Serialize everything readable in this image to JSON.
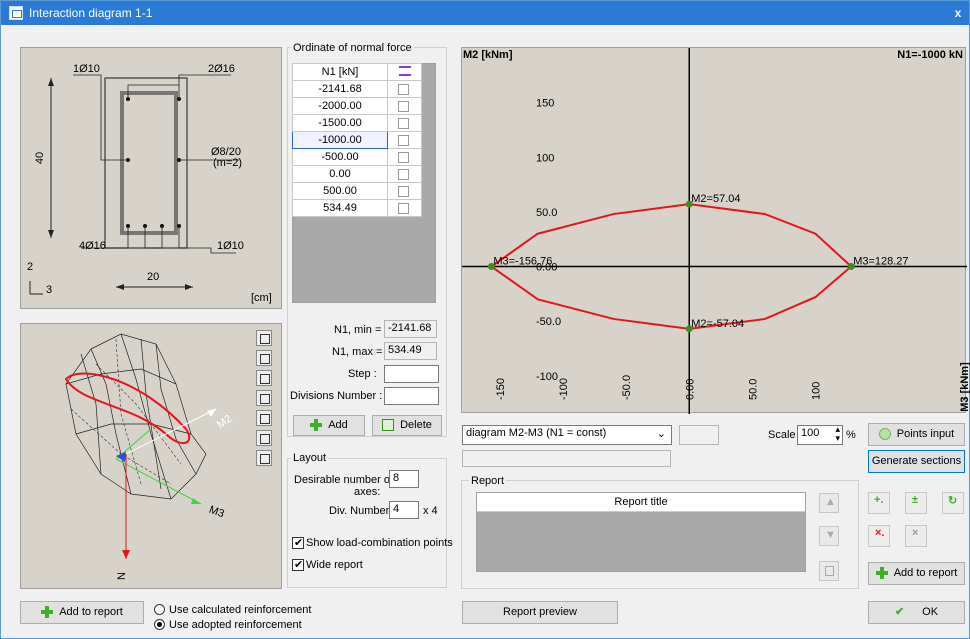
{
  "window": {
    "title": "Interaction diagram 1-1",
    "close_label": "x"
  },
  "section": {
    "label_top_left": "1Ø10",
    "label_top_right": "2Ø16",
    "label_stirrup": "Ø8/20",
    "label_stirrup_m": "(m=2)",
    "label_bottom_left": "4Ø16",
    "label_bottom_right": "1Ø10",
    "dim_height": "40",
    "dim_width": "20",
    "axis_2": "2",
    "axis_3": "3",
    "unit": "[cm]"
  },
  "view3d": {
    "label_m2": "M2",
    "label_m3": "M3",
    "label_n": "N"
  },
  "normal_force": {
    "title": "Ordinate of normal force",
    "col_header": "N1 [kN]",
    "rows": [
      "-2141.68",
      "-2000.00",
      "-1500.00",
      "-1000.00",
      "-500.00",
      "0.00",
      "500.00",
      "534.49"
    ],
    "n1_min_label": "N1, min =",
    "n1_min": "-2141.68",
    "n1_max_label": "N1, max =",
    "n1_max": "534.49",
    "step_label": "Step :",
    "step_value": "",
    "divisions_label": "Divisions Number :",
    "divisions_value": "",
    "add_label": "Add",
    "delete_label": "Delete"
  },
  "layout": {
    "title": "Layout",
    "desirable_label_1": "Desirable number of",
    "desirable_label_2": "axes:",
    "desirable_value": "8",
    "div_label": "Div. Number",
    "div_value": "4",
    "div_suffix": "x 4",
    "show_points_label": "Show load-combination points",
    "wide_report_label": "Wide report"
  },
  "chart_data": {
    "type": "line",
    "title_left": "M2 [kNm]",
    "title_right": "N1=-1000 kN",
    "ylabel_right": "M3 [kNm]",
    "x_ticks": [
      "-150",
      "-100",
      "-50.0",
      "0.00",
      "50.0",
      "100"
    ],
    "y_ticks": [
      "150",
      "100",
      "50.0",
      "0.00",
      "-50.0",
      "-100"
    ],
    "xlim": [
      -180,
      220
    ],
    "ylim": [
      -135,
      200
    ],
    "grid": false,
    "series": [
      {
        "x": [
          -156.76,
          -120,
          -60,
          0,
          60,
          100,
          128.27,
          100,
          60,
          0,
          -60,
          -120,
          -156.76
        ],
        "y": [
          0,
          30,
          48,
          57.04,
          48,
          30,
          0,
          -28,
          -48,
          -57.04,
          -48,
          -30,
          0
        ],
        "color": "#e8141b"
      }
    ],
    "point_labels": [
      {
        "x": 0,
        "y": 57.04,
        "text": "M2=57.04"
      },
      {
        "x": 0,
        "y": -57.04,
        "text": "M2=-57.04"
      },
      {
        "x": -156.76,
        "y": 0,
        "text": "M3=-156.76"
      },
      {
        "x": 128.27,
        "y": 0,
        "text": "M3=128.27"
      }
    ]
  },
  "controls": {
    "diagram_select": "diagram M2-M3 (N1 = const)",
    "scale_label": "Scale",
    "scale_value": "100",
    "scale_unit": "%",
    "points_input_label": "Points input",
    "generate_sections_label": "Generate sections",
    "report_title": "Report",
    "report_col_header": "Report title",
    "add_to_report_label": "Add to report",
    "report_preview_label": "Report preview",
    "ok_label": "OK"
  },
  "bottom": {
    "add_to_report_label": "Add to report",
    "radio_calc": "Use calculated reinforcement",
    "radio_adopted": "Use adopted reinforcement"
  },
  "colors": {
    "accent": "#2a7ad6",
    "curve": "#e8141b",
    "panel_bg": "#d7d3cb",
    "point": "#3a8f1f"
  }
}
